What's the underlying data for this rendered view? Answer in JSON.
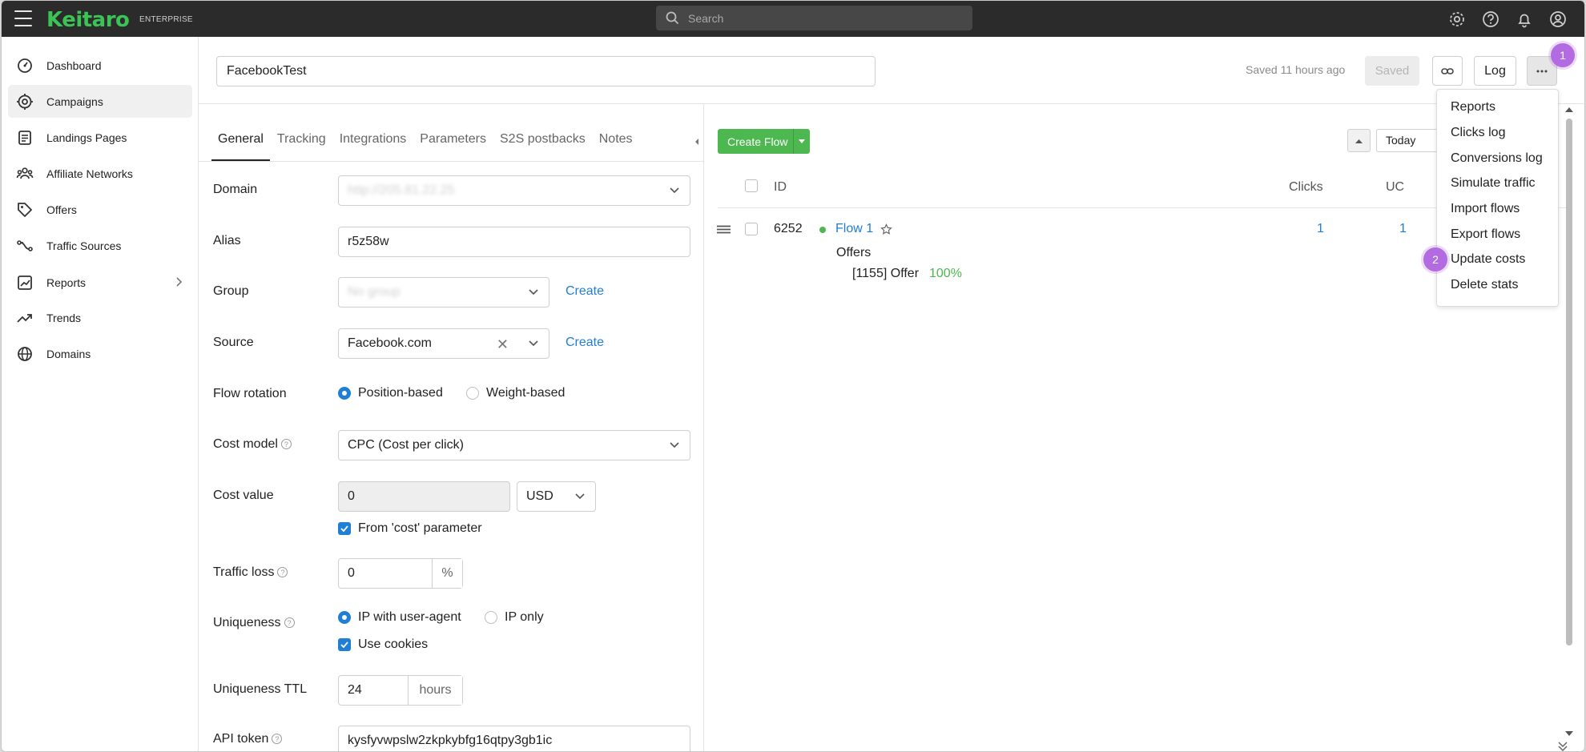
{
  "app": {
    "logo": "Keitaro",
    "edition": "ENTERPRISE",
    "search_placeholder": "Search"
  },
  "top_icons": [
    "gear-icon",
    "help-icon",
    "bell-icon",
    "user-icon"
  ],
  "sidebar": {
    "items": [
      {
        "label": "Dashboard",
        "icon": "dashboard-icon"
      },
      {
        "label": "Campaigns",
        "icon": "target-icon",
        "active": true
      },
      {
        "label": "Landings Pages",
        "icon": "page-icon"
      },
      {
        "label": "Affiliate Networks",
        "icon": "network-icon"
      },
      {
        "label": "Offers",
        "icon": "tag-icon"
      },
      {
        "label": "Traffic Sources",
        "icon": "source-icon"
      },
      {
        "label": "Reports",
        "icon": "chart-icon",
        "has_submenu": true
      },
      {
        "label": "Trends",
        "icon": "trend-icon"
      },
      {
        "label": "Domains",
        "icon": "globe-icon"
      }
    ]
  },
  "header": {
    "campaign_name": "FacebookTest",
    "saved_status": "Saved 11 hours ago",
    "saved_button": "Saved",
    "log_button": "Log",
    "badge_1": "1",
    "badge_2": "2"
  },
  "tabs": [
    "General",
    "Tracking",
    "Integrations",
    "Parameters",
    "S2S postbacks",
    "Notes"
  ],
  "form": {
    "domain_label": "Domain",
    "domain_value": "http://205.81.22.25",
    "alias_label": "Alias",
    "alias_value": "r5z58w",
    "group_label": "Group",
    "group_value": "No group",
    "group_create": "Create",
    "source_label": "Source",
    "source_value": "Facebook.com",
    "source_create": "Create",
    "rotation_label": "Flow rotation",
    "rotation_opt1": "Position-based",
    "rotation_opt2": "Weight-based",
    "cost_model_label": "Cost model",
    "cost_model_value": "CPC (Cost per click)",
    "cost_value_label": "Cost value",
    "cost_value": "0",
    "currency": "USD",
    "cost_param_check": "From 'cost' parameter",
    "traffic_loss_label": "Traffic loss",
    "traffic_loss_value": "0",
    "traffic_loss_unit": "%",
    "uniqueness_label": "Uniqueness",
    "uniq_opt1": "IP with user-agent",
    "uniq_opt2": "IP only",
    "use_cookies": "Use cookies",
    "ttl_label": "Uniqueness TTL",
    "ttl_value": "24",
    "ttl_unit": "hours",
    "api_label": "API token",
    "api_value": "kysfyvwpslw2zkpkybfg16qtpy3gb1ic"
  },
  "flows": {
    "create_button": "Create Flow",
    "date_filter": "Today",
    "columns": {
      "id": "ID",
      "clicks": "Clicks",
      "uc": "UC"
    },
    "rows": [
      {
        "id": "6252",
        "name": "Flow 1",
        "clicks": "1",
        "uc": "1",
        "offers_label": "Offers",
        "offer": "[1155] Offer",
        "share": "100%"
      }
    ]
  },
  "menu": {
    "items": [
      "Reports",
      "Clicks log",
      "Conversions log",
      "Simulate traffic",
      "Import flows",
      "Export flows",
      "Update costs",
      "Delete stats"
    ]
  }
}
